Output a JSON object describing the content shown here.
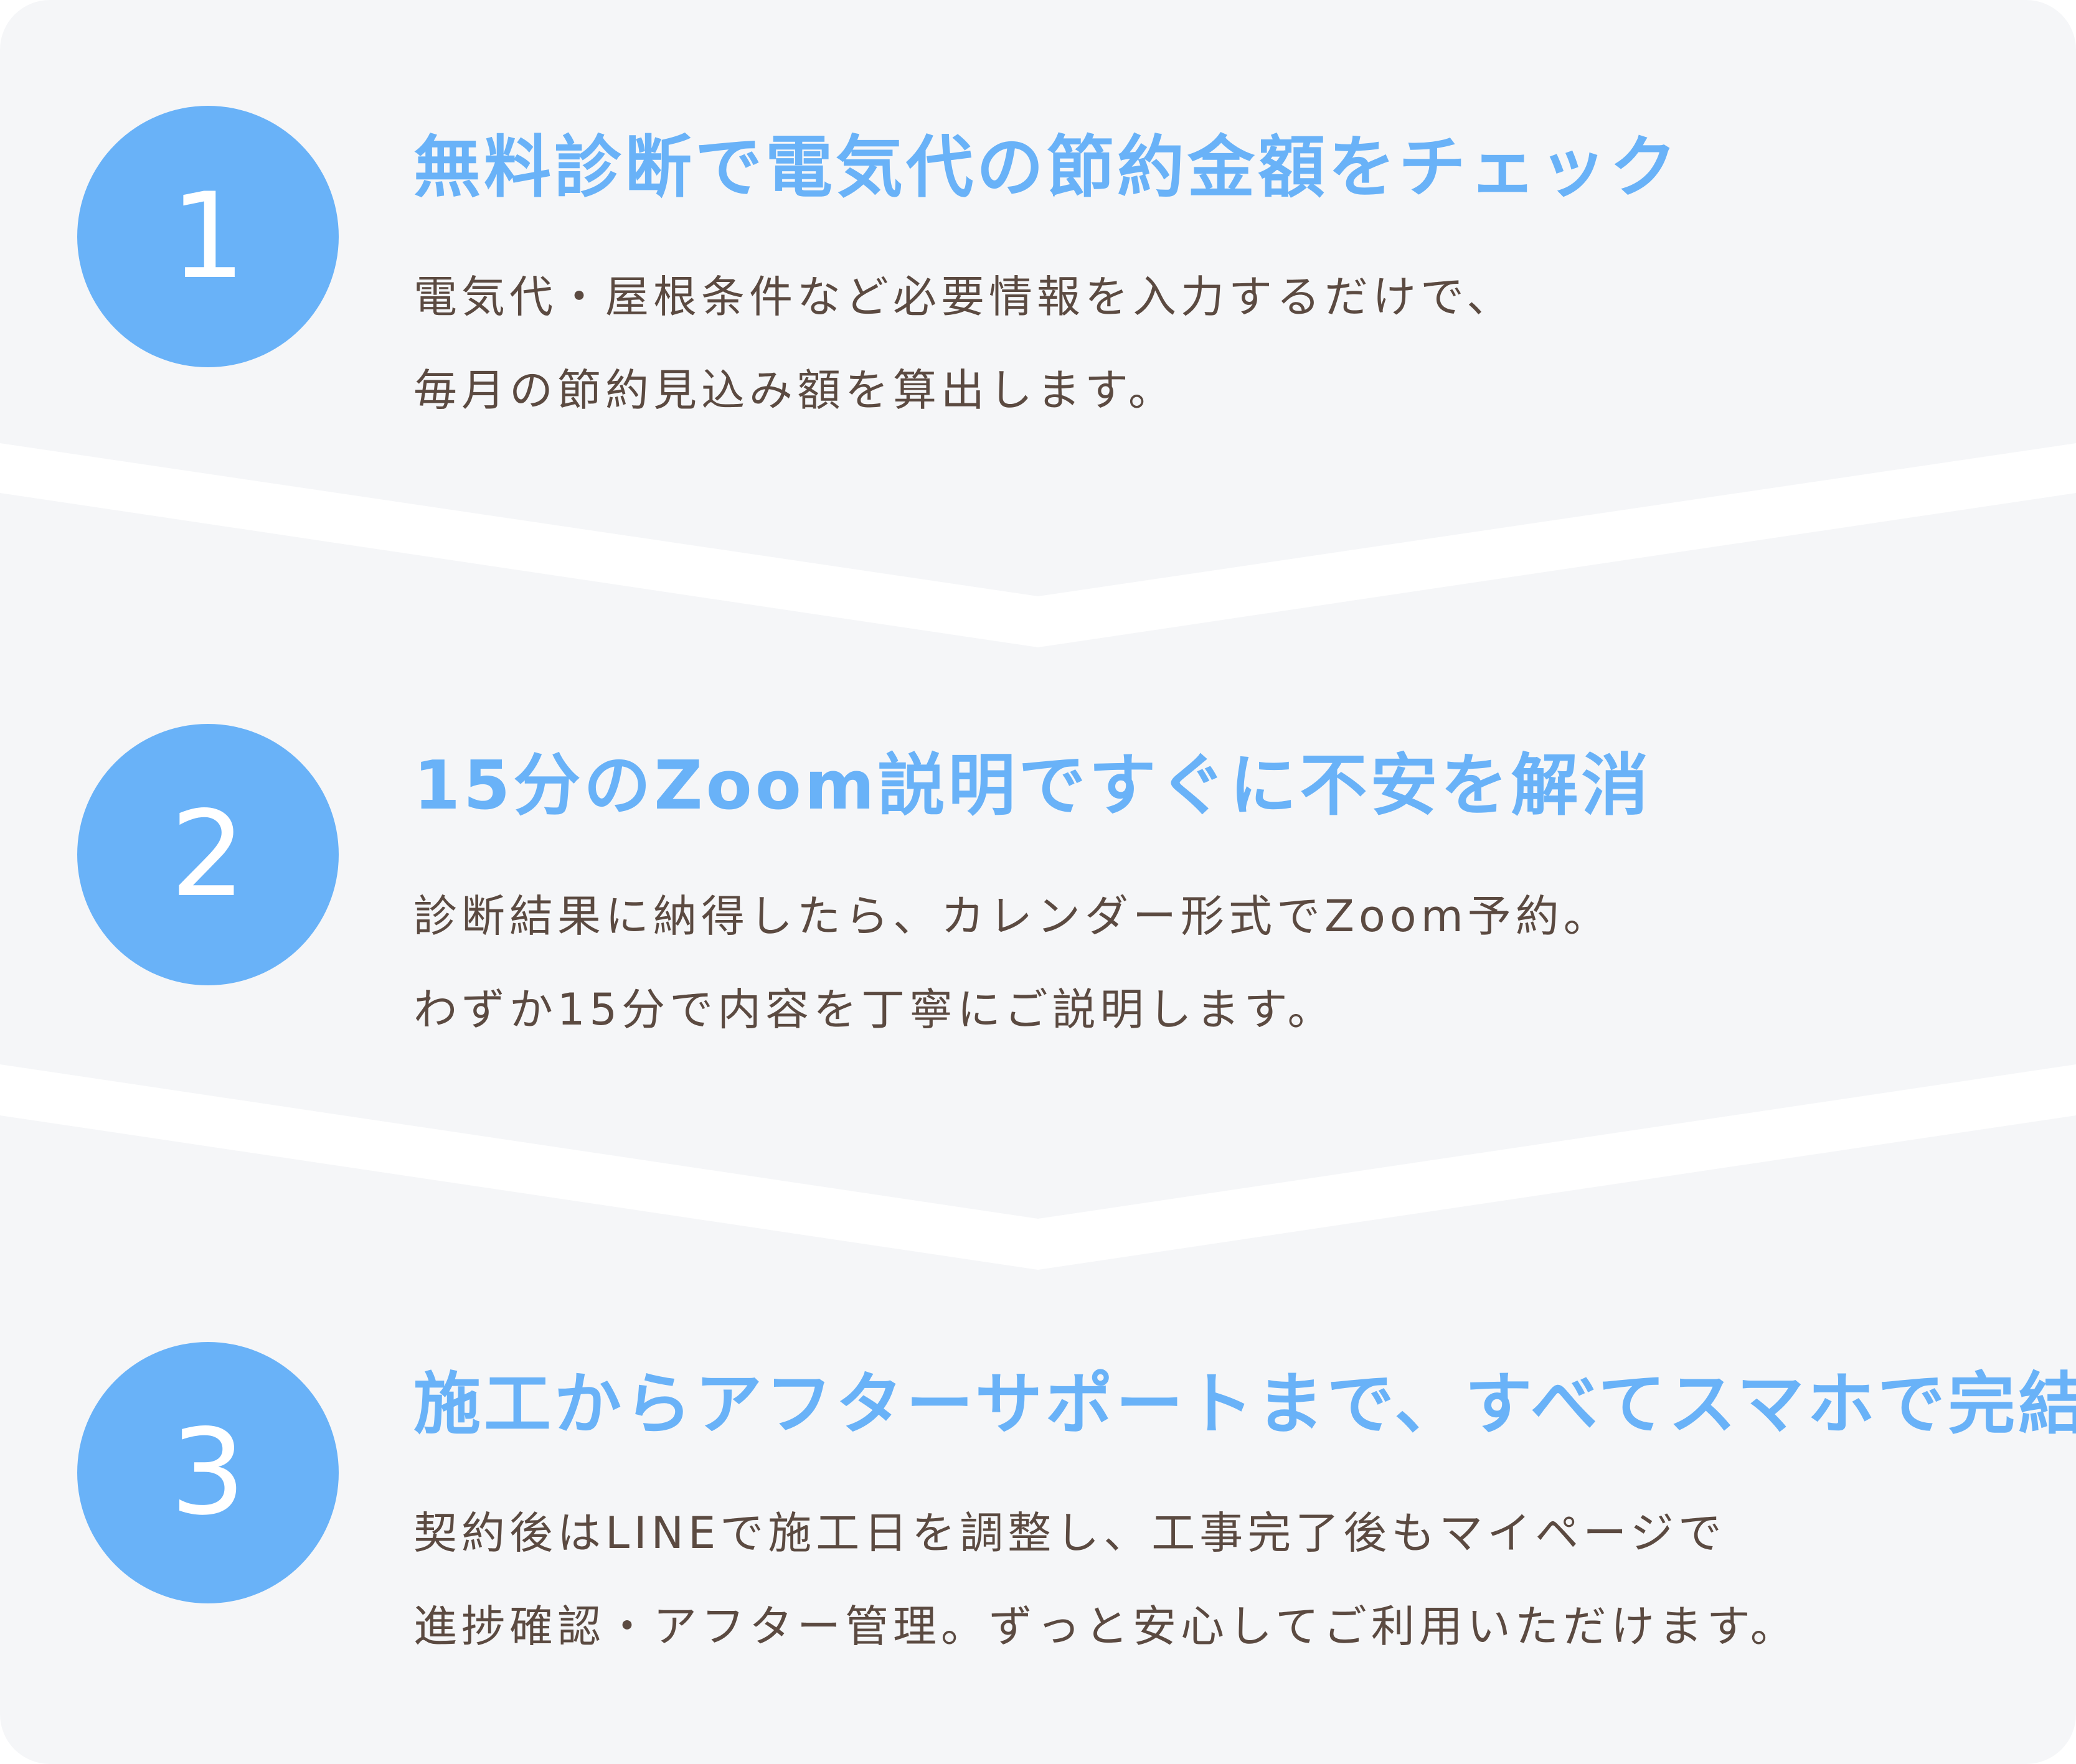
{
  "colors": {
    "accent": "#69b2f8",
    "panel": "#f5f6f8",
    "text": "#5b4a41",
    "divider": "#ffffff"
  },
  "steps": [
    {
      "number": "1",
      "title": "無料診断で電気代の節約金額をチェック",
      "lines": [
        "電気代・屋根条件など必要情報を入力するだけで、",
        "毎月の節約見込み額を算出します。"
      ]
    },
    {
      "number": "2",
      "title": "15分のZoom説明ですぐに不安を解消",
      "lines": [
        "診断結果に納得したら、カレンダー形式でZoom予約。",
        "わずか15分で内容を丁寧にご説明します。"
      ]
    },
    {
      "number": "3",
      "title": "施工からアフターサポートまで、すべてスマホで完結",
      "lines": [
        "契約後はLINEで施工日を調整し、工事完了後もマイページで",
        "進捗確認・アフター管理。ずっと安心してご利用いただけます。"
      ]
    }
  ]
}
